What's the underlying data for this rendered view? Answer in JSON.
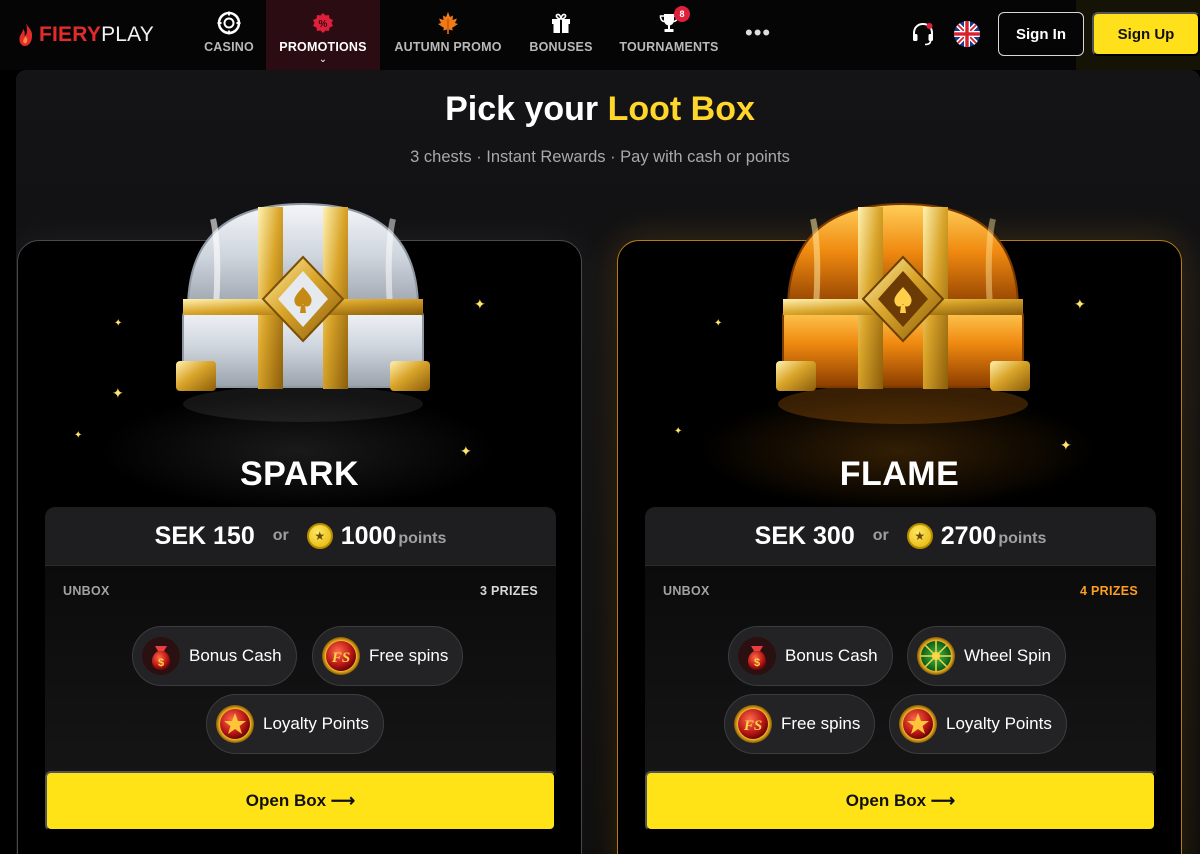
{
  "brand": {
    "name_part1": "FIERY",
    "name_part2": "PLAY",
    "accent": "#e32b2b"
  },
  "nav": {
    "items": [
      {
        "label": "CASINO",
        "icon": "casino-chip-icon"
      },
      {
        "label": "PROMOTIONS",
        "icon": "promotion-tag-icon",
        "active": true
      },
      {
        "label": "AUTUMN PROMO",
        "icon": "maple-leaf-icon"
      },
      {
        "label": "BONUSES",
        "icon": "gift-icon"
      },
      {
        "label": "TOURNAMENTS",
        "icon": "trophy-icon",
        "badge": "8"
      }
    ],
    "more": "•••",
    "support_icon": "headset-icon",
    "language_icon": "uk-flag-icon",
    "signin_label": "Sign In",
    "signup_label": "Sign Up"
  },
  "page": {
    "heading_part1": "Pick your ",
    "heading_highlight": "Loot Box",
    "subheading": "3 chests · Instant Rewards · Pay with cash or points"
  },
  "boxes": [
    {
      "name": "SPARK",
      "price_cash": "SEK 150",
      "or_label": "or",
      "price_points": "1000",
      "points_unit": "points",
      "unbox_label": "UNBOX",
      "prize_count": "3 PRIZES",
      "prizes": [
        {
          "label": "Bonus Cash",
          "icon": "money-bag-icon"
        },
        {
          "label": "Free spins",
          "icon": "free-spins-icon"
        },
        {
          "label": "Loyalty Points",
          "icon": "star-coin-icon"
        }
      ],
      "open_label": "Open Box ⟶"
    },
    {
      "name": "FLAME",
      "price_cash": "SEK 300",
      "or_label": "or",
      "price_points": "2700",
      "points_unit": "points",
      "unbox_label": "UNBOX",
      "prize_count": "4 PRIZES",
      "prizes": [
        {
          "label": "Bonus Cash",
          "icon": "money-bag-icon"
        },
        {
          "label": "Wheel Spin",
          "icon": "wheel-icon"
        },
        {
          "label": "Free spins",
          "icon": "free-spins-icon"
        },
        {
          "label": "Loyalty Points",
          "icon": "star-coin-icon"
        }
      ],
      "open_label": "Open Box ⟶"
    }
  ],
  "colors": {
    "yellow": "#ffe316",
    "flame_accent": "#ff9d20",
    "active_tab": "#e0204a"
  }
}
